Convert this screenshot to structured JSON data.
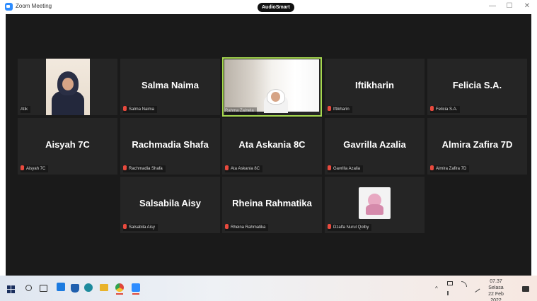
{
  "window": {
    "title": "Zoom Meeting",
    "center_badge": "AudioSmart",
    "controls": {
      "minimize": "—",
      "maximize": "☐",
      "close": "✕"
    }
  },
  "colors": {
    "meeting_bg": "#1a1a1a",
    "tile_bg": "#252525",
    "active_speaker_border": "#a6d84f",
    "muted_mic": "#e84a3e"
  },
  "tiles": {
    "atik": {
      "label": "Atik",
      "video": true,
      "muted": false
    },
    "salma": {
      "name": "Salma Naima",
      "label": "Salma Naima",
      "muted": true
    },
    "rahma": {
      "label": "Rahma Zainela",
      "video": true,
      "active_speaker": true,
      "muted": false
    },
    "iftikharin": {
      "name": "Iftikharin",
      "label": "Iftikharin",
      "muted": true
    },
    "felicia": {
      "name": "Felicia S.A.",
      "label": "Felicia S.A.",
      "muted": true
    },
    "aisyah": {
      "name": "Aisyah 7C",
      "label": "Aisyah 7C",
      "muted": true
    },
    "rachmadia": {
      "name": "Rachmadia Shafa",
      "label": "Rachmadia Shafa",
      "muted": true
    },
    "ata": {
      "name": "Ata Askania 8C",
      "label": "Ata Askania 8C",
      "muted": true
    },
    "gavrilla": {
      "name": "Gavrilla Azalia",
      "label": "Gavrilla Azalia",
      "muted": true
    },
    "almira": {
      "name": "Almira Zafira 7D",
      "label": "Almira Zafira 7D",
      "muted": true
    },
    "salsabila": {
      "name": "Salsabila Aisy",
      "label": "Salsabila Aisy",
      "muted": true
    },
    "rheina": {
      "name": "Rheina Rahmatika",
      "label": "Rheina Rahmatika",
      "muted": true
    },
    "dzalfa": {
      "label": "Dzalfa Nurul Qolby",
      "avatar_image": true,
      "muted": true
    }
  },
  "taskbar": {
    "pinned_icons": [
      "windows-start-icon",
      "search-icon",
      "task-view-icon",
      "app-l-icon",
      "mail-icon",
      "edge-icon",
      "folder-icon",
      "chrome-icon",
      "zoom-icon"
    ],
    "tray_chevron": "^",
    "clock": {
      "time": "07.37",
      "day": "Selasa",
      "date": "22 Feb 2022"
    }
  }
}
